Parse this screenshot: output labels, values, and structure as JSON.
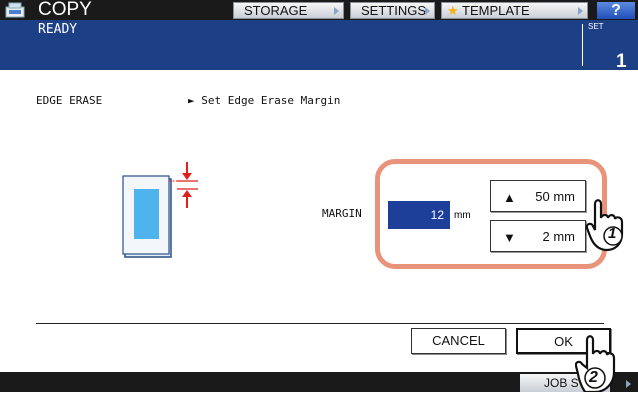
{
  "app": {
    "title": "COPY"
  },
  "toolbar": {
    "storage": "STORAGE",
    "settings": "SETTINGS",
    "template": "TEMPLATE",
    "help": "?"
  },
  "status": {
    "text": "READY",
    "set_label": "SET",
    "set_count": "1"
  },
  "function": {
    "name": "EDGE ERASE",
    "description": "► Set Edge Erase Margin"
  },
  "margin": {
    "label": "MARGIN",
    "value": "12",
    "unit": "mm"
  },
  "stepper": {
    "up_label": "50 mm",
    "down_label": "2 mm"
  },
  "actions": {
    "cancel": "CANCEL",
    "ok": "OK"
  },
  "callouts": {
    "first": "1",
    "second": "2"
  },
  "footer": {
    "job_label": "JOB S"
  },
  "colors": {
    "topbar": "#1a1a1a",
    "statusbar": "#1d3f86",
    "highlight": "#e8937a",
    "value_bg": "#1d3f9a",
    "arrow": "#e0201a"
  },
  "icons": {
    "app": "copier-icon",
    "template": "star-icon",
    "up": "triangle-up-icon",
    "down": "triangle-down-icon",
    "hand": "pointing-hand-icon"
  }
}
